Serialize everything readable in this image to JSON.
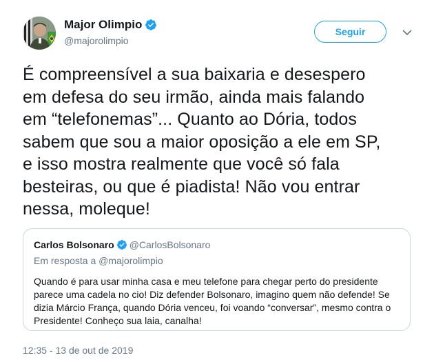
{
  "author": {
    "display_name": "Major Olimpio",
    "handle": "@majorolimpio",
    "verified_icon": "verified-badge-icon"
  },
  "actions": {
    "follow_label": "Seguir",
    "more_icon": "chevron-down-icon"
  },
  "tweet": {
    "text": "É compreensível a sua baixaria e desespero\nem defesa do seu irmão, ainda mais falando\nem “telefonemas”... Quanto ao Dória, todos\nsabem que sou a maior oposição a ele em SP,\ne isso mostra realmente que você só fala\nbesteiras, ou que é piadista! Não vou entrar\nnessa, moleque!",
    "timestamp": "12:35 - 13 de out de 2019"
  },
  "quoted_tweet": {
    "display_name": "Carlos Bolsonaro",
    "handle": "@CarlosBolsonaro",
    "reply_context": "Em resposta a @majorolimpio",
    "text": "Quando é para usar minha casa e meu telefone para chegar perto do presidente parece uma cadela no cio! Diz defender Bolsonaro, imagino quem não defende! Se dizia Márcio França, quando Dória venceu, foi voando “conversar”, mesmo contra o Presidente! Conheço sua laia, canalha!"
  },
  "colors": {
    "accent": "#1da1f2",
    "text_primary": "#14171a",
    "text_secondary": "#657786",
    "border": "#ccd6dd"
  }
}
